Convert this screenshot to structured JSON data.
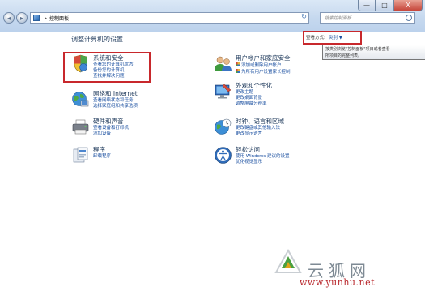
{
  "window": {
    "minimize_label": "—",
    "maximize_label": "□",
    "close_label": "X"
  },
  "address": {
    "crumb": "控制面板",
    "separator": "▸",
    "back_label": "◂",
    "forward_label": "▸",
    "refresh_label": "↻"
  },
  "search": {
    "placeholder": "搜索控制面板"
  },
  "header": {
    "title": "调整计算机的设置",
    "view_by_label": "查看方式:",
    "view_by_value": "类别",
    "view_by_caret": "▼"
  },
  "tooltip": {
    "line1": "按类别浏览\"控制面板\"项目或者查看",
    "line2": "所项目的完整列表。"
  },
  "categories": {
    "system_security": {
      "title": "系统和安全",
      "links": [
        "查看您的计算机状态",
        "备份您的计算机",
        "查找并解决问题"
      ]
    },
    "network": {
      "title": "网络和 Internet",
      "links": [
        "查看网络状态和任务",
        "选择家庭组和共享选项"
      ]
    },
    "hardware": {
      "title": "硬件和声音",
      "links": [
        "查看设备和打印机",
        "添加设备"
      ]
    },
    "programs": {
      "title": "程序",
      "links": [
        "卸载程序"
      ]
    },
    "user_accounts": {
      "title": "用户帐户和家庭安全",
      "links": [
        "添加或删除用户帐户",
        "为所有用户设置家长控制"
      ]
    },
    "appearance": {
      "title": "外观和个性化",
      "links": [
        "更改主题",
        "更改桌面背景",
        "调整屏幕分辨率"
      ]
    },
    "clock_region": {
      "title": "时钟、语言和区域",
      "links": [
        "更改键盘或其他输入法",
        "更改显示语言"
      ]
    },
    "ease_of_access": {
      "title": "轻松访问",
      "links": [
        "使用 Windows 建议的设置",
        "优化视觉显示"
      ]
    }
  },
  "watermark": {
    "text": "云狐网",
    "url": "www.yunhu.net"
  },
  "colors": {
    "link": "#1a4fa0",
    "heading": "#1e395b",
    "highlight_box": "#c8282c"
  }
}
